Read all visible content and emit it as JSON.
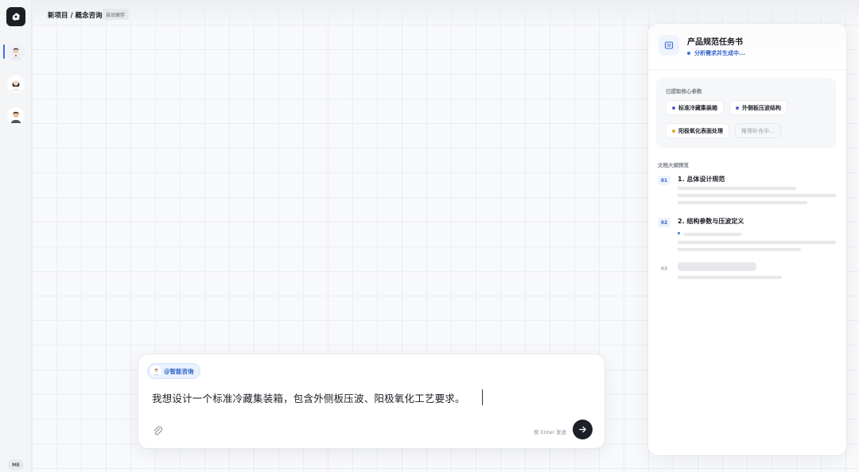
{
  "header": {
    "breadcrumb": "新项目 / 概念咨询",
    "autosave": "自动保存"
  },
  "sidebar": {
    "me_label": "ME"
  },
  "chat": {
    "mention": "@智能咨询",
    "input_value": "我想设计一个标准冷藏集装箱，包含外侧板压波、阳极氧化工艺要求。",
    "send_hint": "按 Enter 发送"
  },
  "panel": {
    "title": "产品规范任务书",
    "status": "分析需求并生成中...",
    "params_label": "已提取核心参数",
    "tags": [
      {
        "label": "标准冷藏集装箱",
        "color": "#5b5fc7"
      },
      {
        "label": "外侧板压波结构",
        "color": "#5b5fc7"
      },
      {
        "label": "阳极氧化表面处理",
        "color": "#e0a92a"
      }
    ],
    "pending_tag": "推理补充中...",
    "outline_label": "文档大纲预览",
    "sections": [
      {
        "num": "01",
        "title": "1. 总体设计规范"
      },
      {
        "num": "02",
        "title": "2. 结构参数与压波定义"
      },
      {
        "num": "03",
        "title": ""
      }
    ]
  },
  "colors": {
    "accent": "#3b6fe0",
    "dark": "#1c1f26"
  }
}
